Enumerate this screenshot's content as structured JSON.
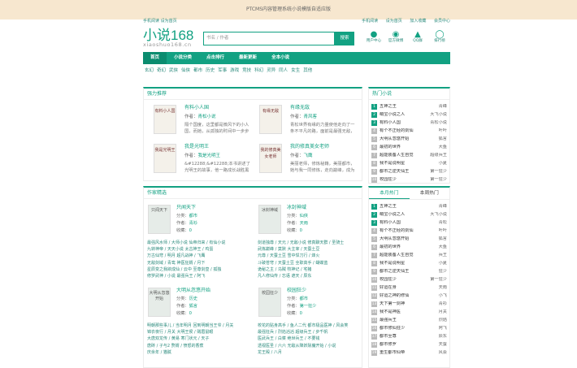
{
  "notice": "PTCMS内容管理系统小说模版自适应版",
  "topbar": {
    "left": [
      "手机阅读",
      "设为首页"
    ],
    "right": [
      "手机阅读",
      "设为首页",
      "加入收藏",
      "会员中心"
    ]
  },
  "logo": {
    "title": "小说168",
    "domain": "xiaoshuo168.cn"
  },
  "search": {
    "placeholder": "书名 / 作者",
    "button": "搜索"
  },
  "quick": [
    {
      "icon": "user-icon",
      "label": "用户中心"
    },
    {
      "icon": "weibo-icon",
      "label": "官方微博"
    },
    {
      "icon": "qq-icon",
      "label": "QQ群"
    },
    {
      "icon": "rank-icon",
      "label": "排行榜"
    }
  ],
  "nav": [
    "首页",
    "小说分类",
    "点击排行",
    "最新更新",
    "全本小说"
  ],
  "categories": [
    "玄幻",
    "奇幻",
    "武侠",
    "仙侠",
    "都市",
    "历史",
    "军事",
    "游戏",
    "竞技",
    "科幻",
    "灵异",
    "同人",
    "女生",
    "其他"
  ],
  "recommend": {
    "title": "强力推荐",
    "books": [
      {
        "cover": "有料小人国",
        "title": "有料小人国",
        "author": "青松小说",
        "desc": "隔个国度，这里都是微风下的小人国，而她，从孤独的时间中一步步长出来，一把"
      },
      {
        "cover": "有缘无敌",
        "title": "有缘无敌",
        "author": "青风客",
        "desc": "青松世界有缘的力量使他走向了一条不平凡的路，面前是最强无敌，看他热血的故事"
      },
      {
        "cover": "我是光明王",
        "title": "我是光明王",
        "author": "我是光明王",
        "desc": "&#12288;&#12288;本书讲述了光明王的故事，他一路成长战胜黑暗走向光明的传奇"
      },
      {
        "cover": "我的修真美女老师",
        "title": "我的修真美女老师",
        "author": "飞鹰",
        "desc": "美丽老师，修炼秘籍，美丽都市，她与我一同修炼，走向巅峰，成为最强高手"
      }
    ]
  },
  "works": {
    "title": "作家精选",
    "items": [
      {
        "cover": "只闻天下",
        "title": "只闻天下",
        "category": "都市",
        "author": "青衫",
        "count": "0",
        "links": [
          "最强风水师 / 大师小说",
          "仙帝归来 / 有仙小说",
          "九转神帝 / 天天小说",
          "太古神王 / 鸡蛋",
          "万古仙穹 / 明月",
          "超凡战神 / 飞鹰",
          "无敌剑域 / 青鸾",
          "神医狂婿 / 月下",
          "星辰变之我欲成仙 / 云中",
          "至尊剑皇 / 孤独",
          "修罗武神 / 小说",
          "最强兵王 / 阿飞"
        ]
      },
      {
        "cover": "冰封神域",
        "title": "冰封神域",
        "category": "仙侠",
        "author": "天雨",
        "count": "0",
        "links": [
          "剑道独尊 / 天元 / 无敌小说",
          "修真聊天群 / 圣骑士",
          "武炼巅峰 / 莫默",
          "大主宰 / 天蚕土豆",
          "元尊 / 天蚕土豆",
          "雪中悍刀行 / 烽火",
          "斗破苍穹 / 天蚕土豆",
          "全职高手 / 蝴蝶蓝",
          "诡秘之主 / 乌贼",
          "牧神记 / 宅猪",
          "凡人修仙传 / 忘语",
          "遮天 / 辰东"
        ]
      },
      {
        "cover": "大明从忽悠开始",
        "title": "大明从忽悠开始",
        "category": "历史",
        "author": "狐言",
        "count": "0",
        "links": [
          "明朝那些事儿 / 当年明月",
          "回到明朝当王爷 / 月关",
          "锦衣夜行 / 月关",
          "大明王侯 / 贼眉鼠眼",
          "大唐双龙传 / 黄易",
          "寒门状元 / 天子",
          "唐砖 / 孑与2",
          "赘婿 / 愤怒的香蕉",
          "庆余年 / 猫腻"
        ]
      },
      {
        "cover": "校园狂少",
        "title": "校园狂少",
        "category": "都市",
        "author": "第一狂少",
        "count": "0",
        "links": [
          "校花的贴身高手 / 鱼人二代",
          "都市极品医神 / 风会笑",
          "最强狂兵 / 烈焰滔滔",
          "超级兵王 / 步千帆",
          "医武兵王 / 白菜",
          "绝世兵王 / 不要钱",
          "透视医圣 / 六六",
          "无敌从降妖除魔开始 / 小说",
          "龙王殿 / 八月"
        ]
      }
    ]
  },
  "hot": {
    "title": "热门小说",
    "items": [
      {
        "name": "五神之王",
        "author": "青峰"
      },
      {
        "name": "萌宝小说之人",
        "author": "大飞小说"
      },
      {
        "name": "有料小人国",
        "author": "青松小说"
      },
      {
        "name": "有个不正经的剑仙",
        "author": "叶叶"
      },
      {
        "name": "大明从忽悠开始",
        "author": "狐言"
      },
      {
        "name": "最初的世界",
        "author": "大鱼"
      },
      {
        "name": "超能装备人生自觉",
        "author": "超级兵王"
      },
      {
        "name": "我不是说明星",
        "author": "小夏"
      },
      {
        "name": "都市之逆天仙王",
        "author": "第一狂少"
      },
      {
        "name": "校园狂少",
        "author": "第一狂少"
      }
    ]
  },
  "rank": {
    "tabs": [
      "本月热门",
      "本周热门"
    ],
    "items": [
      {
        "name": "五神之王",
        "author": "青峰"
      },
      {
        "name": "萌宝小说之人",
        "author": "大飞小说"
      },
      {
        "name": "有料小人国",
        "author": "青松"
      },
      {
        "name": "有个不正经的剑仙",
        "author": "叶叶"
      },
      {
        "name": "大明从忽悠开始",
        "author": "狐言"
      },
      {
        "name": "最初的世界",
        "author": "大鱼"
      },
      {
        "name": "超能装备人生自觉",
        "author": "兵王"
      },
      {
        "name": "我不是说明星",
        "author": "小夏"
      },
      {
        "name": "都市之逆天仙王",
        "author": "狂少"
      },
      {
        "name": "校园狂少",
        "author": "第一狂少"
      },
      {
        "name": "好运在身",
        "author": "天雨"
      },
      {
        "name": "好运之神的修仙",
        "author": "小飞"
      },
      {
        "name": "天下第一剑神",
        "author": "青衫"
      },
      {
        "name": "我不是神医",
        "author": "月关"
      },
      {
        "name": "最强兵王",
        "author": "烈焰"
      },
      {
        "name": "都市修仙狂少",
        "author": "阿飞"
      },
      {
        "name": "都市至尊",
        "author": "辰东"
      },
      {
        "name": "都市修罗",
        "author": "天蚕"
      },
      {
        "name": "重生都市仙帝",
        "author": "风会"
      }
    ]
  }
}
